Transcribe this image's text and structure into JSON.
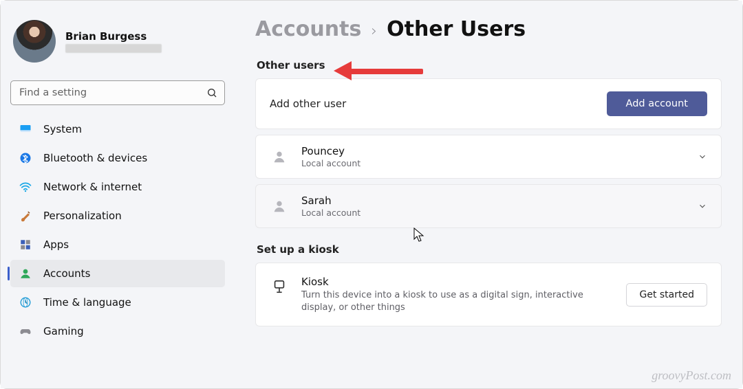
{
  "profile": {
    "name": "Brian Burgess"
  },
  "search": {
    "placeholder": "Find a setting"
  },
  "sidebar": {
    "items": [
      {
        "label": "System"
      },
      {
        "label": "Bluetooth & devices"
      },
      {
        "label": "Network & internet"
      },
      {
        "label": "Personalization"
      },
      {
        "label": "Apps"
      },
      {
        "label": "Accounts"
      },
      {
        "label": "Time & language"
      },
      {
        "label": "Gaming"
      }
    ]
  },
  "breadcrumb": {
    "root": "Accounts",
    "sep": "›",
    "leaf": "Other Users"
  },
  "sections": {
    "other_users_heading": "Other users",
    "kiosk_heading": "Set up a kiosk"
  },
  "add_row": {
    "label": "Add other user",
    "button": "Add account"
  },
  "users": [
    {
      "name": "Pouncey",
      "sub": "Local account"
    },
    {
      "name": "Sarah",
      "sub": "Local account"
    }
  ],
  "kiosk": {
    "title": "Kiosk",
    "desc": "Turn this device into a kiosk to use as a digital sign, interactive display, or other things",
    "button": "Get started"
  },
  "watermark": "groovyPost.com",
  "colors": {
    "accent": "#4f5b99",
    "arrow": "#e63b3b"
  }
}
